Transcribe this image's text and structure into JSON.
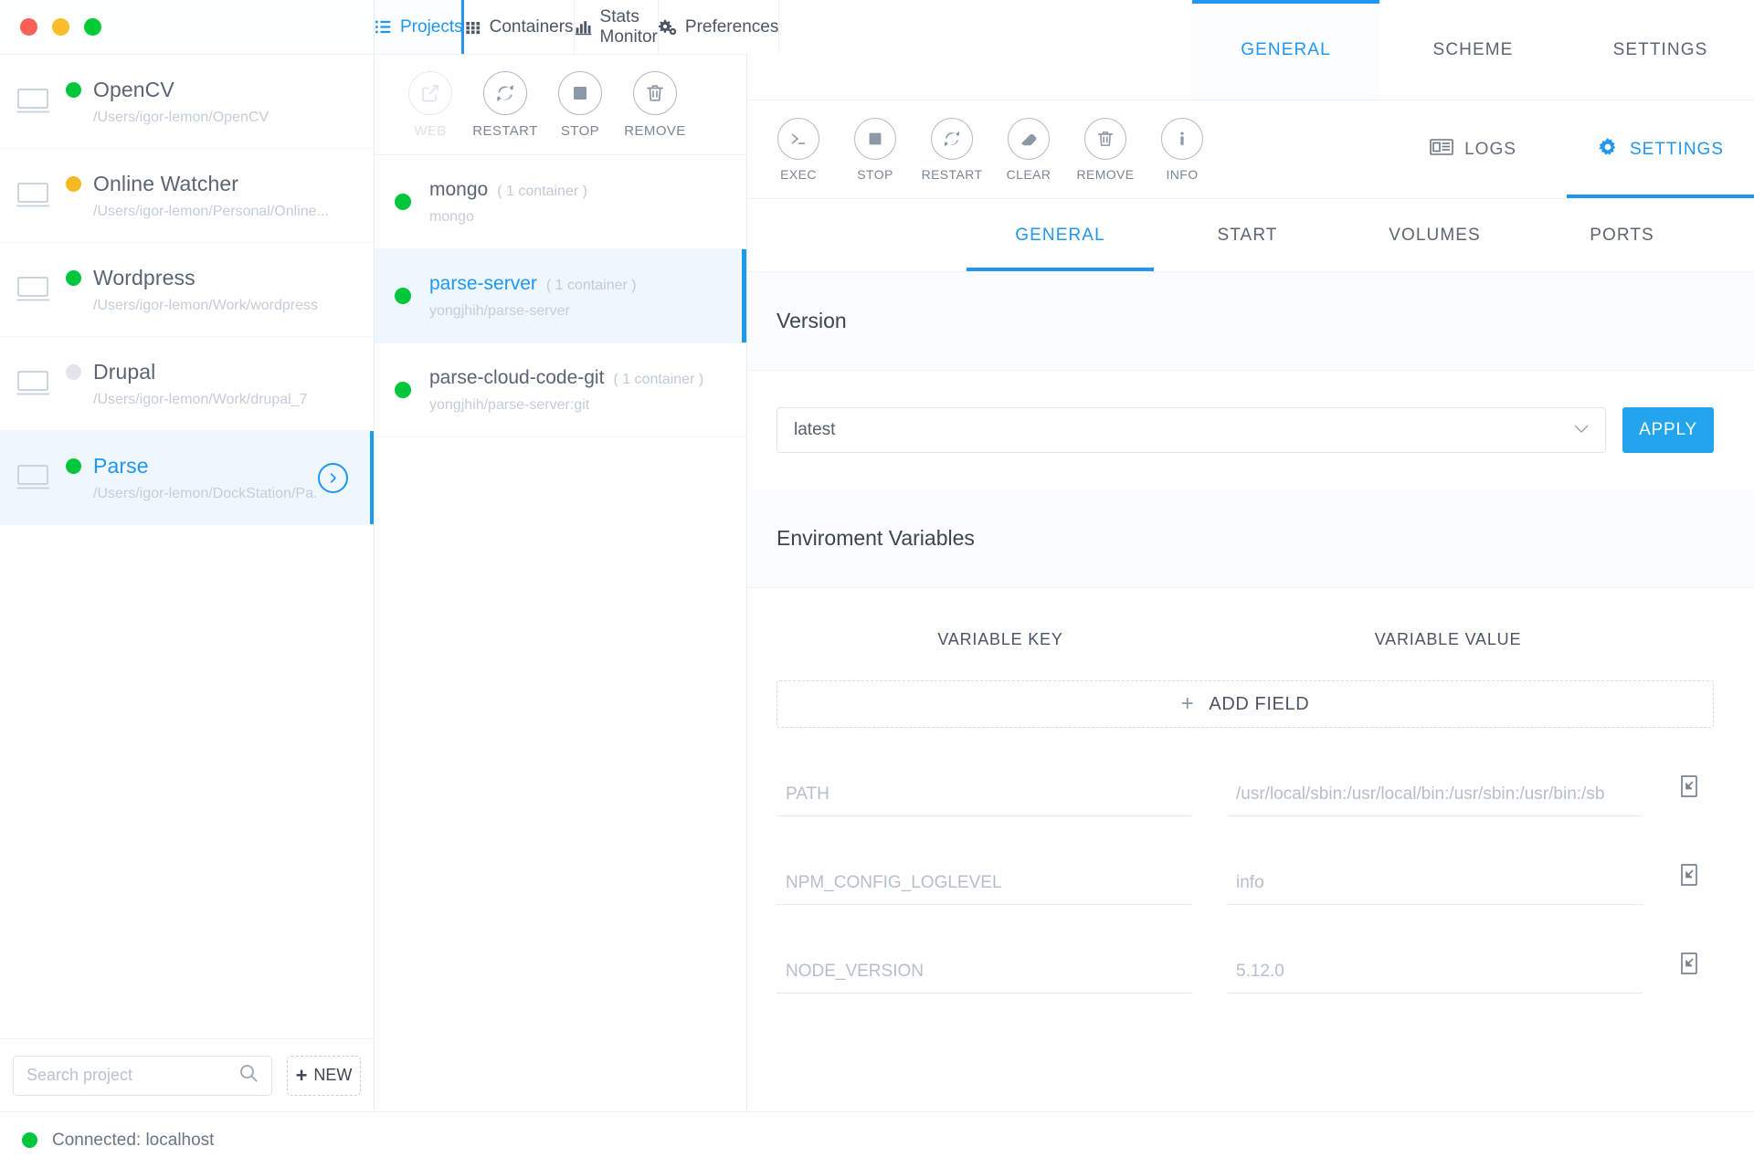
{
  "window": {
    "traffic_lights": [
      {
        "name": "close",
        "color": "#fb6058"
      },
      {
        "name": "minimize",
        "color": "#fcbd2a"
      },
      {
        "name": "maximize",
        "color": "#00ca34"
      }
    ]
  },
  "colors": {
    "accent": "#2196f3",
    "accent_bar": "#1e9ae8",
    "apply_button": "#22a5ec",
    "status_running": "#00c63c",
    "status_partial": "#f5b923",
    "status_stopped": "#e2e4e8",
    "selected_row": "#eff7fe"
  },
  "top_tabs": [
    {
      "label": "Projects",
      "icon": "list-icon",
      "active": true
    },
    {
      "label": "Containers",
      "icon": "grid-icon",
      "active": false
    },
    {
      "label": "Stats Monitor",
      "icon": "bar-chart-icon",
      "active": false
    },
    {
      "label": "Preferences",
      "icon": "gears-icon",
      "active": false
    }
  ],
  "sidebar": {
    "projects": [
      {
        "name": "OpenCV",
        "path": "/Users/igor-lemon/OpenCV",
        "status": "running",
        "selected": false
      },
      {
        "name": "Online Watcher",
        "path": "/Users/igor-lemon/Personal/Online...",
        "status": "partial",
        "selected": false
      },
      {
        "name": "Wordpress",
        "path": "/Users/igor-lemon/Work/wordpress",
        "status": "running",
        "selected": false
      },
      {
        "name": "Drupal",
        "path": "/Users/igor-lemon/Work/drupal_7",
        "status": "stopped",
        "selected": false
      },
      {
        "name": "Parse",
        "path": "/Users/igor-lemon/DockStation/Pa...",
        "status": "running",
        "selected": true
      }
    ],
    "search": {
      "placeholder": "Search project",
      "value": "",
      "icon": "search-icon"
    },
    "new_button": {
      "label": "NEW",
      "icon": "plus-icon"
    }
  },
  "project_toolbar": [
    {
      "label": "WEB",
      "icon": "external-link-icon",
      "disabled": true
    },
    {
      "label": "RESTART",
      "icon": "refresh-icon",
      "disabled": false
    },
    {
      "label": "STOP",
      "icon": "stop-square-icon",
      "disabled": false
    },
    {
      "label": "REMOVE",
      "icon": "trash-icon",
      "disabled": false
    }
  ],
  "containers": [
    {
      "name": "mongo",
      "count": "( 1 container )",
      "image": "mongo",
      "status": "running",
      "selected": false
    },
    {
      "name": "parse-server",
      "count": "( 1 container )",
      "image": "yongjhih/parse-server",
      "status": "running",
      "selected": true
    },
    {
      "name": "parse-cloud-code-git",
      "count": "( 1 container )",
      "image": "yongjhih/parse-server:git",
      "status": "running",
      "selected": false
    }
  ],
  "scheme_tabs": [
    {
      "label": "GENERAL",
      "active": true
    },
    {
      "label": "SCHEME",
      "active": false
    },
    {
      "label": "SETTINGS",
      "active": false
    }
  ],
  "container_toolbar": [
    {
      "label": "EXEC",
      "icon": "terminal-icon"
    },
    {
      "label": "STOP",
      "icon": "stop-square-icon"
    },
    {
      "label": "RESTART",
      "icon": "refresh-icon"
    },
    {
      "label": "CLEAR",
      "icon": "eraser-icon"
    },
    {
      "label": "REMOVE",
      "icon": "trash-icon"
    },
    {
      "label": "INFO",
      "icon": "info-icon"
    }
  ],
  "container_right_tabs": [
    {
      "label": "LOGS",
      "icon": "newspaper-icon",
      "active": false
    },
    {
      "label": "SETTINGS",
      "icon": "gear-icon",
      "active": true
    }
  ],
  "settings_sub_tabs": [
    {
      "label": "GENERAL",
      "active": true
    },
    {
      "label": "START",
      "active": false
    },
    {
      "label": "VOLUMES",
      "active": false
    },
    {
      "label": "PORTS",
      "active": false
    }
  ],
  "version_section": {
    "title": "Version",
    "selected_value": "latest",
    "apply_label": "APPLY"
  },
  "env_section": {
    "title": "Enviroment Variables",
    "col_key_header": "VARIABLE KEY",
    "col_value_header": "VARIABLE VALUE",
    "add_field_label": "ADD FIELD",
    "rows": [
      {
        "key": "PATH",
        "value": "/usr/local/sbin:/usr/local/bin:/usr/sbin:/usr/bin:/sb"
      },
      {
        "key": "NPM_CONFIG_LOGLEVEL",
        "value": "info"
      },
      {
        "key": "NODE_VERSION",
        "value": "5.12.0"
      }
    ]
  },
  "statusbar": {
    "text": "Connected: localhost",
    "status": "connected"
  }
}
